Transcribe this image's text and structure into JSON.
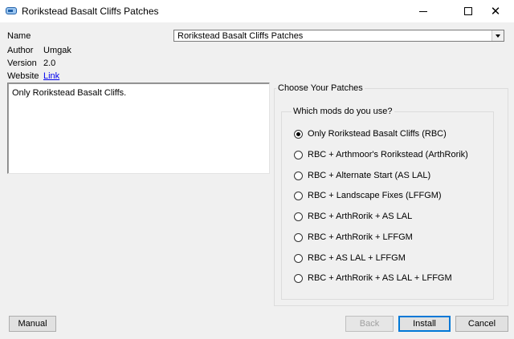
{
  "window": {
    "title": "Rorikstead Basalt Cliffs Patches",
    "minimize_glyph": "",
    "maximize_glyph": "",
    "close_glyph": "✕"
  },
  "info": {
    "name_label": "Name",
    "author_label": "Author",
    "author_value": "Umgak",
    "version_label": "Version",
    "version_value": "2.0",
    "website_label": "Website",
    "website_value": "Link"
  },
  "name_combo": {
    "selected": "Rorikstead Basalt Cliffs Patches"
  },
  "description": {
    "text": "Only Rorikstead Basalt Cliffs."
  },
  "patches": {
    "group_title": "Choose Your Patches",
    "subgroup_title": "Which mods do you use?",
    "options": [
      {
        "label": "Only Rorikstead Basalt Cliffs (RBC)",
        "checked": true
      },
      {
        "label": "RBC + Arthmoor's Rorikstead (ArthRorik)",
        "checked": false
      },
      {
        "label": "RBC + Alternate Start (AS LAL)",
        "checked": false
      },
      {
        "label": "RBC + Landscape Fixes (LFFGM)",
        "checked": false
      },
      {
        "label": "RBC + ArthRorik + AS LAL",
        "checked": false
      },
      {
        "label": "RBC + ArthRorik + LFFGM",
        "checked": false
      },
      {
        "label": "RBC + AS LAL + LFFGM",
        "checked": false
      },
      {
        "label": "RBC + ArthRorik + AS LAL + LFFGM",
        "checked": false
      }
    ]
  },
  "buttons": {
    "manual": "Manual",
    "back": "Back",
    "install": "Install",
    "cancel": "Cancel"
  },
  "colors": {
    "accent": "#0078d7",
    "link": "#0000ee",
    "disabled_text": "#a0a0a0"
  }
}
